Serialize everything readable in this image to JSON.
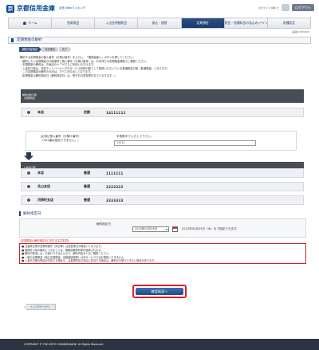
{
  "header": {
    "bank_name": "京都信用金庫",
    "sub_label": "京信 Webバンキング",
    "small_links": "文字サイズ 標準 大",
    "logout_label": "ログアウト"
  },
  "nav": [
    {
      "label": "ホーム",
      "active": false
    },
    {
      "label": "残高照会",
      "active": false
    },
    {
      "label": "入出金明細照会",
      "active": false
    },
    {
      "label": "振込・振替",
      "active": false
    },
    {
      "label": "定期預金",
      "active": true
    },
    {
      "label": "税金・各種料金の払込み(ペイジー)",
      "active": false
    },
    {
      "label": "各種設定",
      "active": false
    }
  ],
  "screen_id": "画面ID:BT0005",
  "page_title": "定期預金の解約",
  "steps": [
    "解約内容指定",
    "内容確認",
    "完了"
  ],
  "info_lines": [
    "解約する定期預金の預入番号（お預け番号）を入力し、「確認画面へ」ボタンを押してください。",
    "・解約したい定期預金の口座番号と預入番号（お預け番号）は、お手持ちの定期預金通帳でご確認ください。",
    "・定期預金の解約は、お届出のＡＴＭでもご利用いただけます。",
    "・入金先口座は、京信ネットバンキングのサービス利用口座として登録いただいている普通預金口座（普通預金）となります。",
    "・この定期預金の解約の元本は、すべてお引出しとなります。",
    "（定期預金の解約指定日（解約指定日）は、受付日の翌営業日までとなります。）"
  ],
  "source_section": {
    "label_line1": "解約対象口座",
    "label_line2": "(定期預金)"
  },
  "source_account": {
    "branch": "本店",
    "type": "定期",
    "number": "14111111"
  },
  "deposit_input": {
    "label_line1": "[必須] 預入番号（お預け番号）",
    "label_line2": "（001番は指定できません。）",
    "hint": "半角数字で入力して下さい。",
    "value": "11111"
  },
  "dest_section": {
    "label_line1": "入金先口座",
    "label_line2": "(普通預金)"
  },
  "dest_accounts": [
    {
      "branch": "本店",
      "type": "普通",
      "number": "1111111"
    },
    {
      "branch": "北山支店",
      "type": "普通",
      "number": "2222222"
    },
    {
      "branch": "河原町支店",
      "type": "普通",
      "number": "3333333"
    }
  ],
  "date_section": {
    "title": "解約指定日",
    "label": "解約指定日",
    "select_value": "2015年02月05日",
    "text": "2015年02月05日（木）まで指定できます。"
  },
  "notes": {
    "head": "【定期預金の解約指定日に関する注意事項】",
    "lines": [
      "■ 当金庫正規の営業時間外（休日等）は翌営業日の取扱いとなります。",
      "■ 満期日以前の解約につきましては、期限前解約利率が適用されます。",
      "■ 解約の取消しは、お受けできませんので、解約内容を十分ご確認ください。",
      "■ 一部の定期預金（積立定期預金、自動継続型等）は本サービスではお取扱いできません。",
      "■ 入金先口座の残高が不足する場合や、当金庫所定の事由に該当する場合は、解約がお受けできない場合があります。"
    ]
  },
  "confirm_label": "確認画面へ",
  "back_label": "トップページへ",
  "footer": "COPYRIGHT © THE KYOTO SHINKIN BANK. All Rights Reserved."
}
